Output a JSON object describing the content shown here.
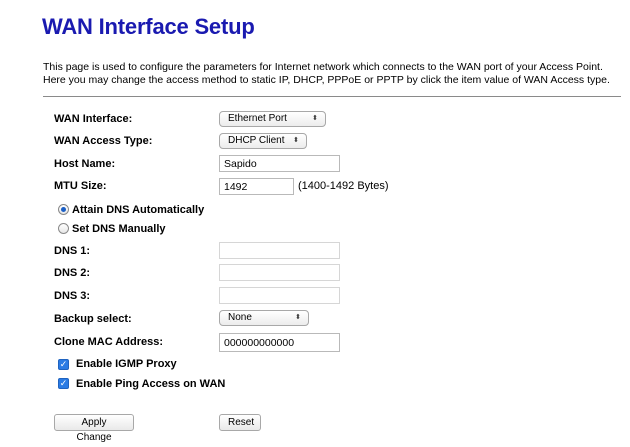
{
  "page": {
    "title": "WAN Interface Setup",
    "description": "This page is used to configure the parameters for Internet network which connects to the WAN port of your Access Point. Here you may change the access method to static IP, DHCP, PPPoE or PPTP by click the item value of WAN Access type."
  },
  "form": {
    "wan_interface": {
      "label": "WAN Interface:",
      "value": "Ethernet Port"
    },
    "wan_access_type": {
      "label": "WAN Access Type:",
      "value": "DHCP Client"
    },
    "host_name": {
      "label": "Host Name:",
      "value": "Sapido"
    },
    "mtu_size": {
      "label": "MTU Size:",
      "value": "1492",
      "hint": "(1400-1492 Bytes)"
    },
    "dns_mode": {
      "auto_label": "Attain DNS Automatically",
      "manual_label": "Set DNS Manually",
      "selected": "auto"
    },
    "dns1": {
      "label": "DNS 1:",
      "value": ""
    },
    "dns2": {
      "label": "DNS 2:",
      "value": ""
    },
    "dns3": {
      "label": "DNS 3:",
      "value": ""
    },
    "backup_select": {
      "label": "Backup select:",
      "value": "None"
    },
    "clone_mac": {
      "label": "Clone MAC Address:",
      "value": "000000000000"
    },
    "igmp_proxy": {
      "label": "Enable IGMP Proxy",
      "checked": true
    },
    "ping_access": {
      "label": "Enable Ping Access on WAN",
      "checked": true
    }
  },
  "buttons": {
    "apply": "Apply Change",
    "reset": "Reset"
  },
  "colors": {
    "title": "#1a1ab0",
    "radio_dot": "#1b5fc5",
    "checkbox": "#2a7be4"
  }
}
